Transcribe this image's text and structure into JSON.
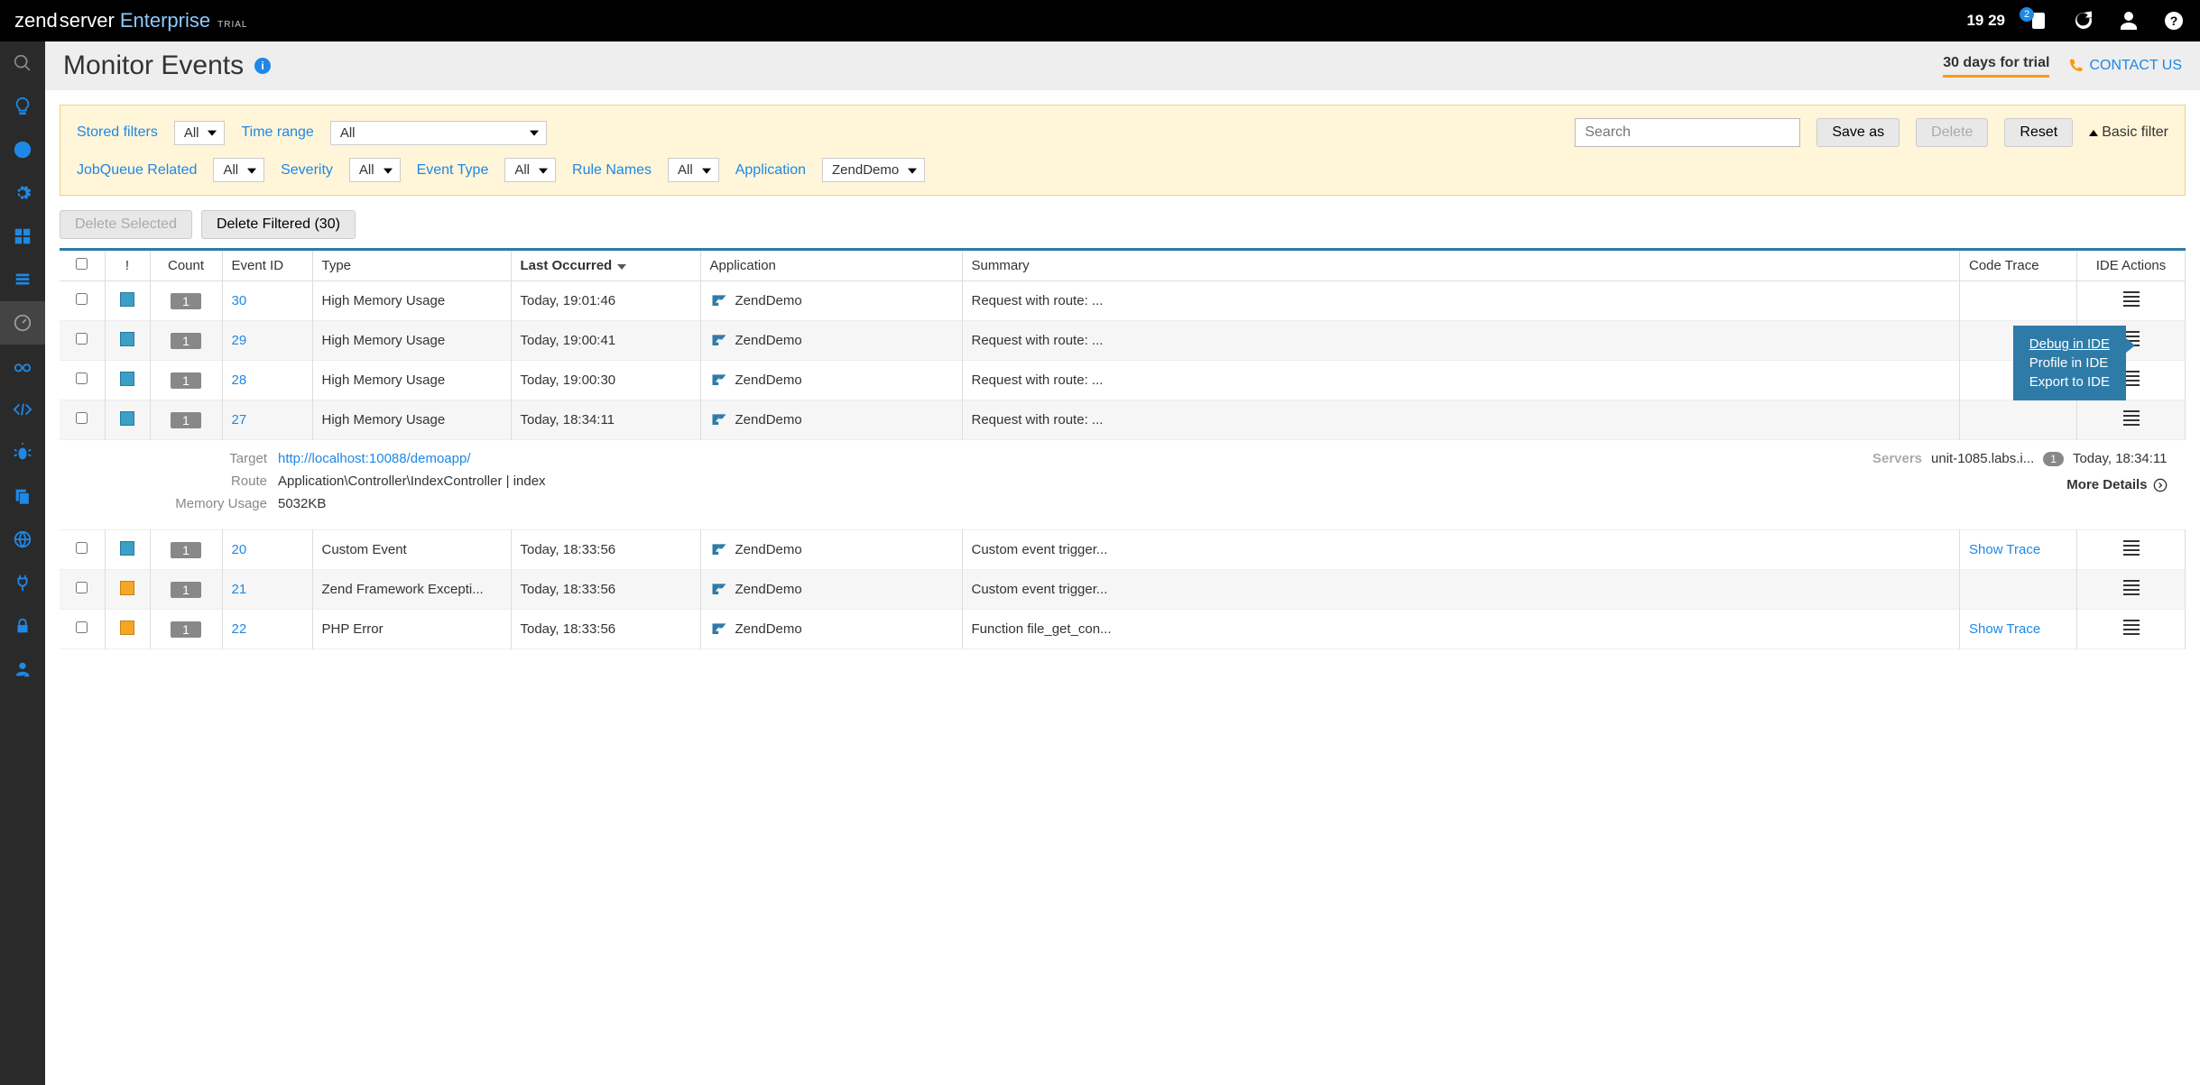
{
  "topbar": {
    "logo_zend": "zend",
    "logo_server": "server",
    "logo_enterprise": "Enterprise",
    "logo_trial": "TRIAL",
    "time": "19 29",
    "notif_count": "2"
  },
  "header": {
    "title": "Monitor Events",
    "trial": "30 days for trial",
    "contact": "CONTACT US"
  },
  "filters": {
    "stored_label": "Stored filters",
    "stored_value": "All",
    "timerange_label": "Time range",
    "timerange_value": "All",
    "search_placeholder": "Search",
    "saveas": "Save as",
    "delete": "Delete",
    "reset": "Reset",
    "basic": "Basic filter",
    "jobqueue_label": "JobQueue Related",
    "jobqueue_value": "All",
    "severity_label": "Severity",
    "severity_value": "All",
    "eventtype_label": "Event Type",
    "eventtype_value": "All",
    "rulenames_label": "Rule Names",
    "rulenames_value": "All",
    "application_label": "Application",
    "application_value": "ZendDemo"
  },
  "actions": {
    "delete_selected": "Delete Selected",
    "delete_filtered": "Delete Filtered (30)"
  },
  "columns": {
    "severity": "!",
    "count": "Count",
    "event_id": "Event ID",
    "type": "Type",
    "last": "Last Occurred",
    "app": "Application",
    "summary": "Summary",
    "trace": "Code Trace",
    "ide": "IDE Actions"
  },
  "rows": [
    {
      "sev": "blue",
      "count": "1",
      "event_id": "30",
      "type": "High Memory Usage",
      "last": "Today, 19:01:46",
      "app": "ZendDemo",
      "summary": "Request with route: ...",
      "trace": ""
    },
    {
      "sev": "blue",
      "count": "1",
      "event_id": "29",
      "type": "High Memory Usage",
      "last": "Today, 19:00:41",
      "app": "ZendDemo",
      "summary": "Request with route: ...",
      "trace": ""
    },
    {
      "sev": "blue",
      "count": "1",
      "event_id": "28",
      "type": "High Memory Usage",
      "last": "Today, 19:00:30",
      "app": "ZendDemo",
      "summary": "Request with route: ...",
      "trace": ""
    },
    {
      "sev": "blue",
      "count": "1",
      "event_id": "27",
      "type": "High Memory Usage",
      "last": "Today, 18:34:11",
      "app": "ZendDemo",
      "summary": "Request with route: ...",
      "trace": ""
    },
    {
      "sev": "blue",
      "count": "1",
      "event_id": "20",
      "type": "Custom Event",
      "last": "Today, 18:33:56",
      "app": "ZendDemo",
      "summary": "Custom event trigger...",
      "trace": "Show Trace"
    },
    {
      "sev": "orange",
      "count": "1",
      "event_id": "21",
      "type": "Zend Framework Excepti...",
      "last": "Today, 18:33:56",
      "app": "ZendDemo",
      "summary": "Custom event trigger...",
      "trace": ""
    },
    {
      "sev": "orange",
      "count": "1",
      "event_id": "22",
      "type": "PHP Error",
      "last": "Today, 18:33:56",
      "app": "ZendDemo",
      "summary": "Function file_get_con...",
      "trace": "Show Trace"
    }
  ],
  "detail": {
    "target_label": "Target",
    "target_value": "http://localhost:10088/demoapp/",
    "route_label": "Route",
    "route_value": "Application\\Controller\\IndexController | index",
    "mem_label": "Memory Usage",
    "mem_value": "5032KB",
    "servers_label": "Servers",
    "server_name": "unit-1085.labs.i...",
    "server_badge": "1",
    "server_time": "Today, 18:34:11",
    "more": "More Details"
  },
  "popup": {
    "debug": "Debug in IDE",
    "profile": "Profile in IDE",
    "export": "Export to IDE"
  }
}
